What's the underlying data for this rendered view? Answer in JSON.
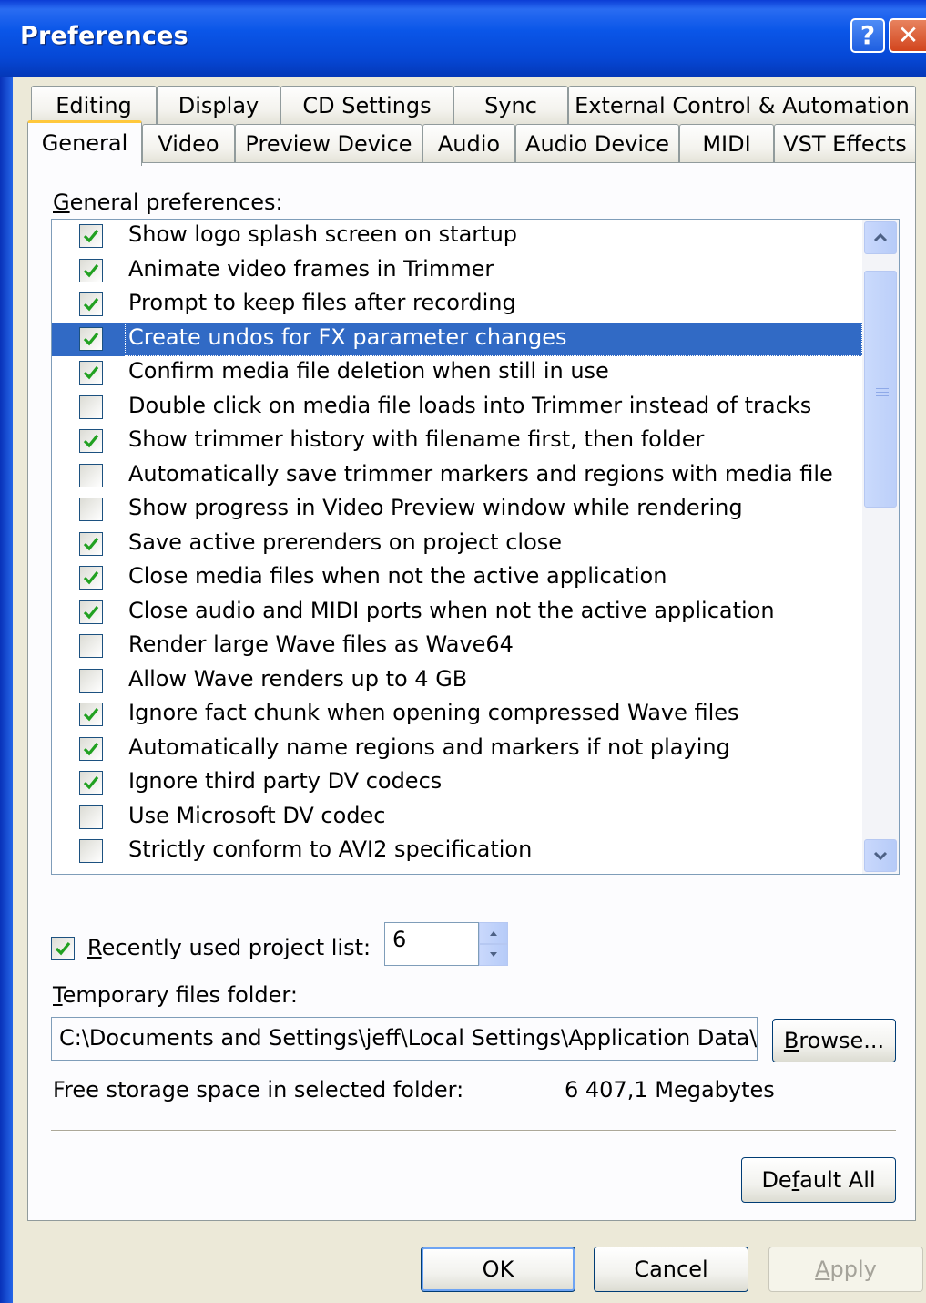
{
  "window": {
    "title": "Preferences"
  },
  "title_buttons": {
    "help": "?",
    "close": "✕"
  },
  "tabs_back": [
    "Editing",
    "Display",
    "CD Settings",
    "Sync",
    "External Control & Automation"
  ],
  "tabs_front": [
    "General",
    "Video",
    "Preview Device",
    "Audio",
    "Audio Device",
    "MIDI",
    "VST Effects"
  ],
  "active_tab": "General",
  "general": {
    "list_label_u": "G",
    "list_label_rest": "eneral preferences:",
    "options": [
      {
        "label": "Show logo splash screen on startup",
        "checked": true
      },
      {
        "label": "Animate video frames in Trimmer",
        "checked": true
      },
      {
        "label": "Prompt to keep files after recording",
        "checked": true
      },
      {
        "label": "Create undos for FX parameter changes",
        "checked": true,
        "selected": true
      },
      {
        "label": "Confirm media file deletion when still in use",
        "checked": true
      },
      {
        "label": "Double click on media file loads into Trimmer instead of tracks",
        "checked": false
      },
      {
        "label": "Show trimmer history with filename first, then folder",
        "checked": true
      },
      {
        "label": "Automatically save trimmer markers and regions with media file",
        "checked": false
      },
      {
        "label": "Show progress in Video Preview window while rendering",
        "checked": false
      },
      {
        "label": "Save active prerenders on project close",
        "checked": true
      },
      {
        "label": "Close media files when not the active application",
        "checked": true
      },
      {
        "label": "Close audio and MIDI ports when not the active application",
        "checked": true
      },
      {
        "label": "Render large Wave files as Wave64",
        "checked": false
      },
      {
        "label": "Allow Wave renders up to 4 GB",
        "checked": false
      },
      {
        "label": "Ignore fact chunk when opening compressed Wave files",
        "checked": true
      },
      {
        "label": "Automatically name regions and markers if not playing",
        "checked": true
      },
      {
        "label": "Ignore third party DV codecs",
        "checked": true
      },
      {
        "label": "Use Microsoft DV codec",
        "checked": false
      },
      {
        "label": "Strictly conform to AVI2 specification",
        "checked": false
      }
    ],
    "recent": {
      "label_u": "R",
      "label_rest": "ecently used project list:",
      "checked": true,
      "value": "6"
    },
    "temp_folder": {
      "label_u": "T",
      "label_rest": "emporary files folder:",
      "value": "C:\\Documents and Settings\\jeff\\Local Settings\\Application Data\\So"
    },
    "browse": {
      "u": "B",
      "rest": "rowse..."
    },
    "free_space": {
      "label": "Free storage space in selected folder:",
      "value": "6 407,1 Megabytes"
    },
    "default_all": {
      "pre": "De",
      "u": "f",
      "post": "ault All"
    }
  },
  "buttons": {
    "ok": "OK",
    "cancel": "Cancel",
    "apply_u": "A",
    "apply_rest": "pply"
  },
  "colors": {
    "selection": "#316ac5",
    "tab_highlight": "#ffc83c",
    "titlebar": "#0a56e8"
  }
}
